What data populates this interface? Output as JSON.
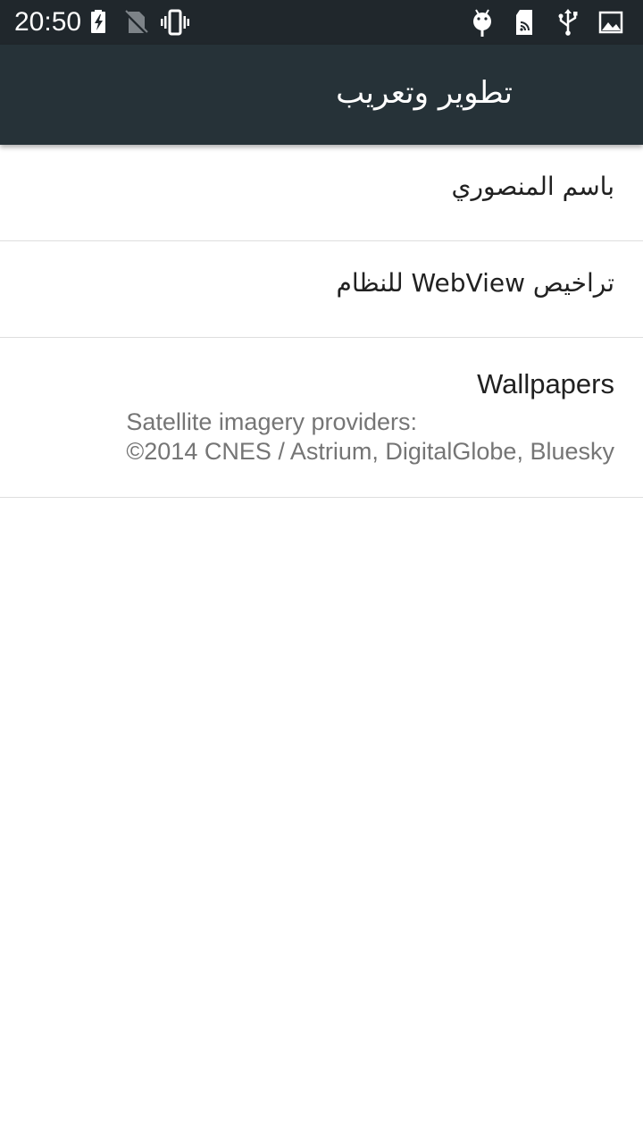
{
  "status_bar": {
    "time": "20:50",
    "icons": [
      "battery-charging-icon",
      "no-sim-icon",
      "vibrate-icon",
      "android-debug-icon",
      "sd-card-icon",
      "usb-icon",
      "image-icon"
    ]
  },
  "app_bar": {
    "title": "تطوير وتعريب"
  },
  "list": {
    "items": [
      {
        "label": "باسم المنصوري"
      },
      {
        "label": "تراخيص WebView للنظام"
      },
      {
        "label": "Wallpapers",
        "summary_line1": "Satellite imagery providers:",
        "summary_line2": "©2014 CNES / Astrium, DigitalGlobe, Bluesky"
      }
    ]
  },
  "colors": {
    "status_bar_bg": "#20272c",
    "app_bar_bg": "#263238",
    "primary_text": "#212121",
    "secondary_text": "#757575",
    "divider": "#dedede"
  }
}
